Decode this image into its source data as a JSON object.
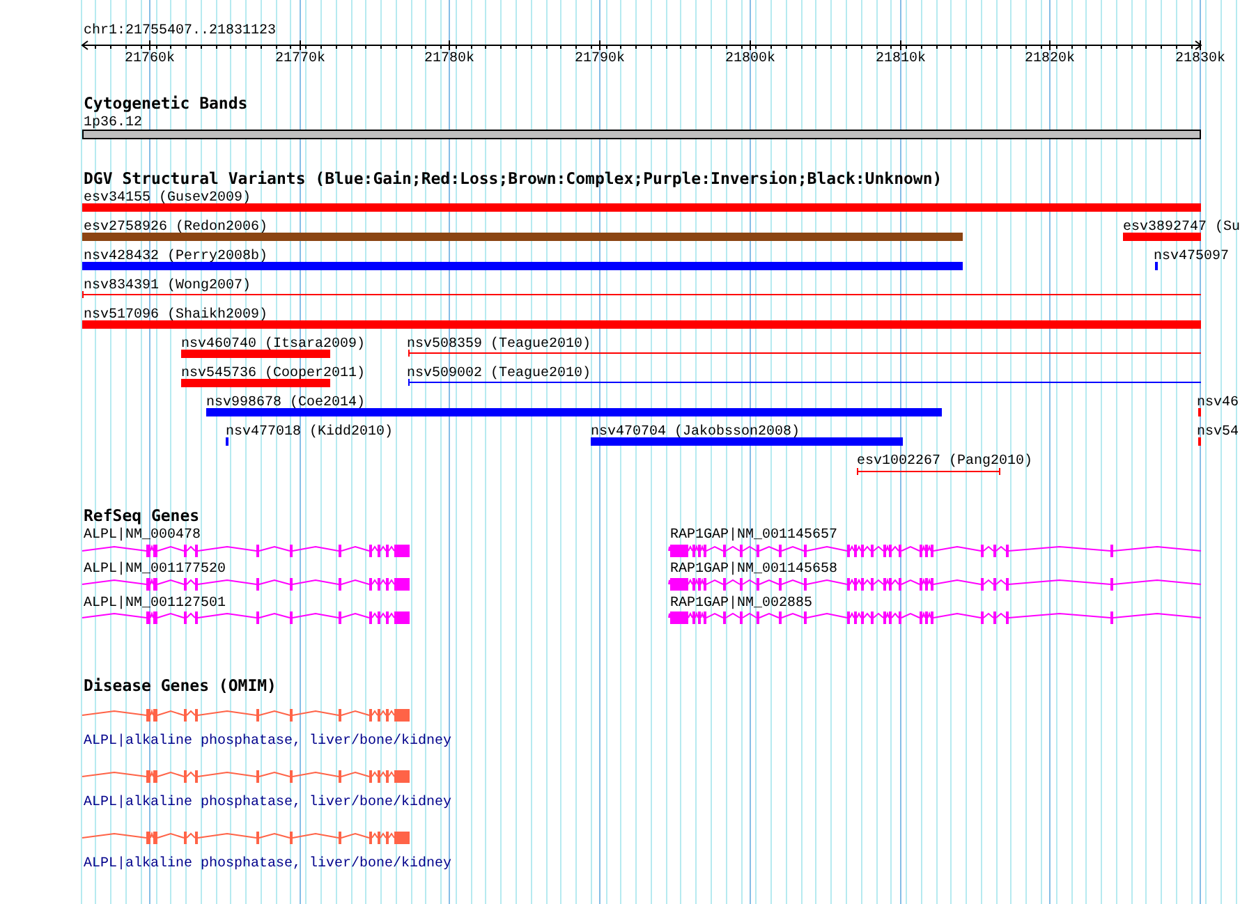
{
  "ruler": {
    "label": "chr1:21755407..21831123",
    "ticks": [
      "21760k",
      "21770k",
      "21780k",
      "21790k",
      "21800k",
      "21810k",
      "21820k",
      "21830k"
    ]
  },
  "cytoband": {
    "title": "Cytogenetic Bands",
    "band": "1p36.12"
  },
  "dgv": {
    "title": "DGV Structural Variants (Blue:Gain;Red:Loss;Brown:Complex;Purple:Inversion;Black:Unknown)",
    "rows": [
      {
        "variants": [
          {
            "label": "esv34155 (Gusev2009)",
            "kind": "bar",
            "color": "#ff0000"
          }
        ]
      },
      {
        "variants": [
          {
            "label": "esv2758926 (Redon2006)",
            "kind": "bar",
            "color": "#8b4513"
          },
          {
            "label": "esv3892747 (Su",
            "kind": "bar",
            "color": "#ff0000"
          }
        ]
      },
      {
        "variants": [
          {
            "label": "nsv428432 (Perry2008b)",
            "kind": "bar",
            "color": "#0000ff"
          },
          {
            "label": "nsv475097",
            "kind": "bar",
            "color": "#0000ff"
          }
        ]
      },
      {
        "variants": [
          {
            "label": "nsv834391 (Wong2007)",
            "kind": "line",
            "color": "#ff0000"
          }
        ]
      },
      {
        "variants": [
          {
            "label": "nsv517096 (Shaikh2009)",
            "kind": "bar",
            "color": "#ff0000"
          }
        ]
      },
      {
        "variants": [
          {
            "label": "nsv460740 (Itsara2009)",
            "kind": "bar",
            "color": "#ff0000"
          },
          {
            "label": "nsv508359 (Teague2010)",
            "kind": "line",
            "color": "#ff0000"
          }
        ]
      },
      {
        "variants": [
          {
            "label": "nsv545736 (Cooper2011)",
            "kind": "bar",
            "color": "#ff0000"
          },
          {
            "label": "nsv509002 (Teague2010)",
            "kind": "line",
            "color": "#0000ff"
          }
        ]
      },
      {
        "variants": [
          {
            "label": "nsv998678 (Coe2014)",
            "kind": "bar",
            "color": "#0000ff"
          },
          {
            "label": "nsv46",
            "kind": "bar",
            "color": "#ff0000"
          }
        ]
      },
      {
        "variants": [
          {
            "label": "nsv477018 (Kidd2010)",
            "kind": "bar",
            "color": "#0000ff"
          },
          {
            "label": "nsv470704 (Jakobsson2008)",
            "kind": "bar",
            "color": "#0000ff"
          },
          {
            "label": "nsv54",
            "kind": "bar",
            "color": "#ff0000"
          }
        ]
      },
      {
        "variants": [
          {
            "label": "esv1002267 (Pang2010)",
            "kind": "span",
            "color": "#ff0000"
          }
        ]
      }
    ]
  },
  "refseq": {
    "title": "RefSeq Genes",
    "rows": [
      {
        "genes": [
          {
            "label": "ALPL|NM_000478"
          },
          {
            "label": "RAP1GAP|NM_001145657"
          }
        ]
      },
      {
        "genes": [
          {
            "label": "ALPL|NM_001177520"
          },
          {
            "label": "RAP1GAP|NM_001145658"
          }
        ]
      },
      {
        "genes": [
          {
            "label": "ALPL|NM_001127501"
          },
          {
            "label": "RAP1GAP|NM_002885"
          }
        ]
      }
    ]
  },
  "omim": {
    "title": "Disease Genes (OMIM)",
    "rows": [
      {
        "label": "ALPL|alkaline phosphatase, liver/bone/kidney"
      },
      {
        "label": "ALPL|alkaline phosphatase, liver/bone/kidney"
      },
      {
        "label": "ALPL|alkaline phosphatase, liver/bone/kidney"
      }
    ]
  }
}
